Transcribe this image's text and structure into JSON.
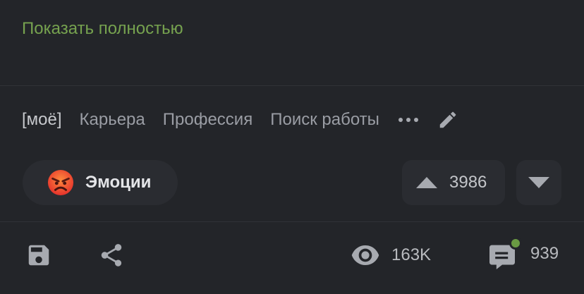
{
  "post": {
    "show_more_label": "Показать полностью"
  },
  "tags": [
    "[моё]",
    "Карьера",
    "Профессия",
    "Поиск работы"
  ],
  "reaction": {
    "label": "Эмоции",
    "icon": "angry-face-icon"
  },
  "rating": {
    "score": "3986"
  },
  "stats": {
    "views": "163K",
    "comments": "939"
  },
  "colors": {
    "background": "#232529",
    "accent_green": "#76a24f",
    "panel": "#2a2c31",
    "new_comment_dot": "#6a9a43"
  },
  "icons": [
    "more-dots-icon",
    "edit-pencil-icon",
    "angry-face-icon",
    "upvote-arrow-icon",
    "downvote-arrow-icon",
    "save-icon",
    "share-icon",
    "eye-icon",
    "comment-icon"
  ]
}
